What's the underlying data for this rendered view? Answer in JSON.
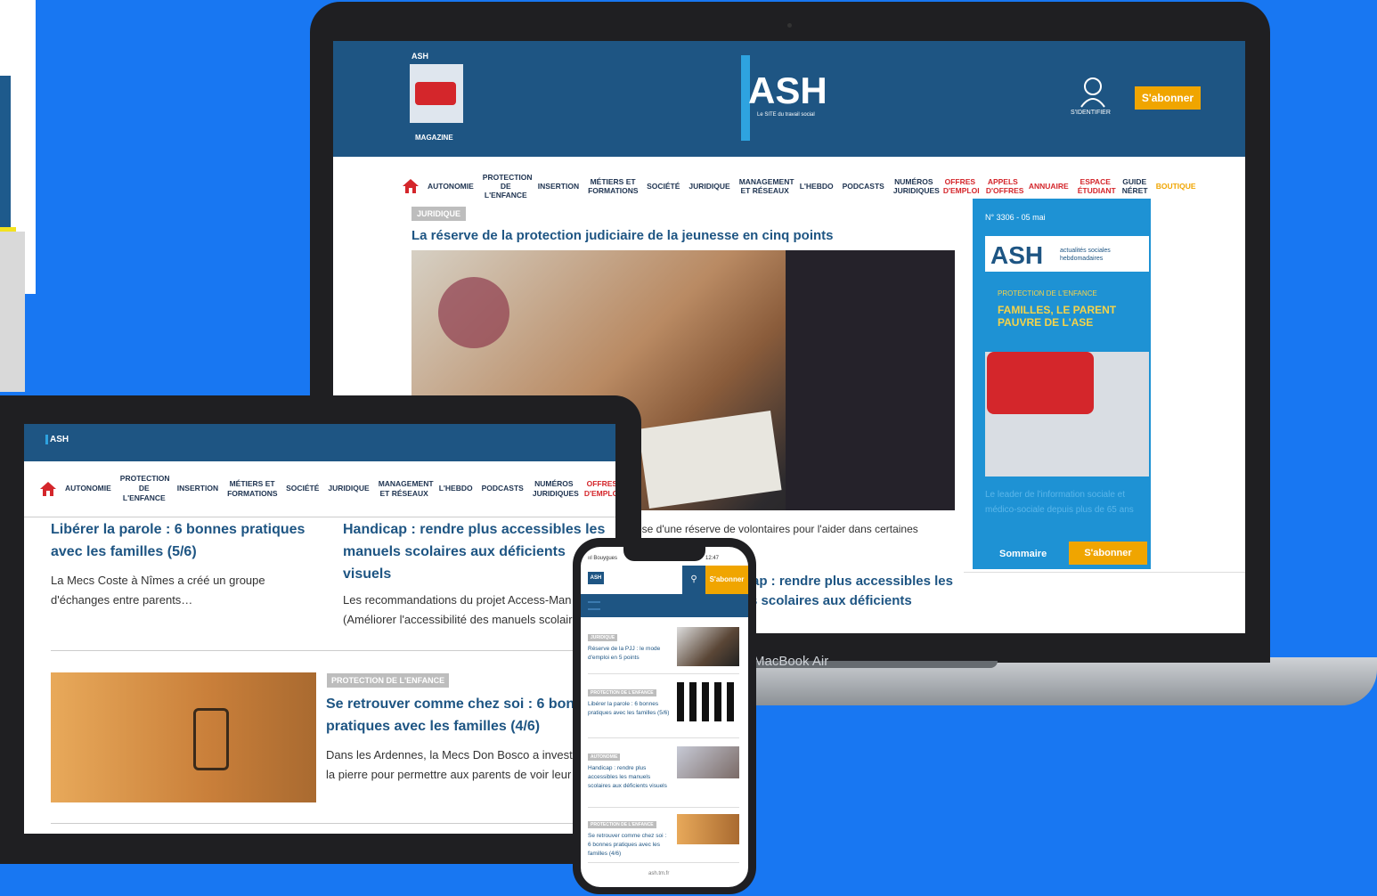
{
  "laptop": {
    "magazine_label": "MAGAZINE",
    "logo": "ASH",
    "logo_sub": "Le SITE du travail social",
    "login_label": "S'IDENTIFIER",
    "subscribe_label": "S'abonner",
    "nav": [
      {
        "label": "AUTONOMIE",
        "color": "normal"
      },
      {
        "label": "PROTECTION DE L'ENFANCE",
        "color": "normal"
      },
      {
        "label": "INSERTION",
        "color": "normal"
      },
      {
        "label": "MÉTIERS ET FORMATIONS",
        "color": "normal"
      },
      {
        "label": "SOCIÉTÉ",
        "color": "normal"
      },
      {
        "label": "JURIDIQUE",
        "color": "normal"
      },
      {
        "label": "MANAGEMENT ET RÉSEAUX",
        "color": "normal"
      },
      {
        "label": "L'HEBDO",
        "color": "normal"
      },
      {
        "label": "PODCASTS",
        "color": "normal"
      },
      {
        "label": "NUMÉROS JURIDIQUES",
        "color": "normal"
      },
      {
        "label": "OFFRES D'EMPLOI",
        "color": "red"
      },
      {
        "label": "APPELS D'OFFRES",
        "color": "red"
      },
      {
        "label": "ANNUAIRE",
        "color": "red"
      },
      {
        "label": "ESPACE ÉTUDIANT",
        "color": "red"
      },
      {
        "label": "GUIDE NÉRET",
        "color": "normal"
      },
      {
        "label": "BOUTIQUE",
        "color": "orange"
      }
    ],
    "article": {
      "tag": "JURIDIQUE",
      "title": "La réserve de la protection judiciaire de la jeunesse en cinq points",
      "caption_partial": "ose d'une réserve de volontaires pour l'aider dans certaines",
      "title2_line1": "ap : rendre plus accessibles les",
      "title2_line2": "s scolaires aux déficients"
    },
    "sidebar": {
      "issue": "N° 3306 - 05 mai",
      "cover_logo": "ASH",
      "cover_logo_side": "actualités sociales hebdomadaires",
      "cover_pre": "PROTECTION DE L'ENFANCE",
      "cover_headline": "FAMILLES, LE PARENT PAUVRE DE L'ASE",
      "lead": "Le leader de l'information sociale et médico-sociale depuis plus de 65 ans",
      "summary_label": "Sommaire",
      "subscribe_label": "S'abonner"
    },
    "device_label": "MacBook Air"
  },
  "tablet": {
    "logo": "ASH",
    "nav": [
      {
        "label": "AUTONOMIE",
        "color": "normal"
      },
      {
        "label": "PROTECTION DE L'ENFANCE",
        "color": "normal"
      },
      {
        "label": "INSERTION",
        "color": "normal"
      },
      {
        "label": "MÉTIERS ET FORMATIONS",
        "color": "normal"
      },
      {
        "label": "SOCIÉTÉ",
        "color": "normal"
      },
      {
        "label": "JURIDIQUE",
        "color": "normal"
      },
      {
        "label": "MANAGEMENT ET RÉSEAUX",
        "color": "normal"
      },
      {
        "label": "L'HEBDO",
        "color": "normal"
      },
      {
        "label": "PODCASTS",
        "color": "normal"
      },
      {
        "label": "NUMÉROS JURIDIQUES",
        "color": "normal"
      },
      {
        "label": "OFFRES D'EMPLOI",
        "color": "red"
      }
    ],
    "article1_title": "Libérer la parole : 6 bonnes pratiques avec les familles (5/6)",
    "article1_desc": "La Mecs Coste à Nîmes a créé un groupe d'échanges entre parents…",
    "article2_title": "Handicap : rendre plus accessibles les manuels scolaires aux déficients visuels",
    "article2_desc_line1": "Les recommandations du projet Access-Man",
    "article2_desc_line2": "(Améliorer l'accessibilité des manuels scolair",
    "article3_tag": "PROTECTION DE L'ENFANCE",
    "article3_title_line1": "Se retrouver comme chez soi : 6 bonn",
    "article3_title_line2": "pratiques avec les familles (4/6)",
    "article3_desc_line1": "Dans les Ardennes, la Mecs Don Bosco a investi",
    "article3_desc_line2": "la pierre pour permettre aux parents de voir leur"
  },
  "phone": {
    "carrier": "ııl Bouygues",
    "time": "12:47",
    "logo": "ASH",
    "subscribe_label": "S'abonner",
    "items": [
      {
        "tag": "JURIDIQUE",
        "title": "Réserve de la PJJ : le mode d'emploi en 5 points"
      },
      {
        "tag": "PROTECTION DE L'ENFANCE",
        "title": "Libérer la parole : 6 bonnes pratiques avec les familles (5/6)"
      },
      {
        "tag": "AUTONOMIE",
        "title": "Handicap : rendre plus accessibles les manuels scolaires aux déficients visuels"
      },
      {
        "tag": "PROTECTION DE L'ENFANCE",
        "title": "Se retrouver comme chez soi : 6 bonnes pratiques avec les familles (4/6)"
      }
    ],
    "url": "ash.tm.fr"
  },
  "colors": {
    "background": "#1877f2",
    "brand_navy": "#1e5583",
    "accent_blue": "#2ea3e0",
    "subscribe_orange": "#f0a500",
    "alert_red": "#d4262b"
  }
}
